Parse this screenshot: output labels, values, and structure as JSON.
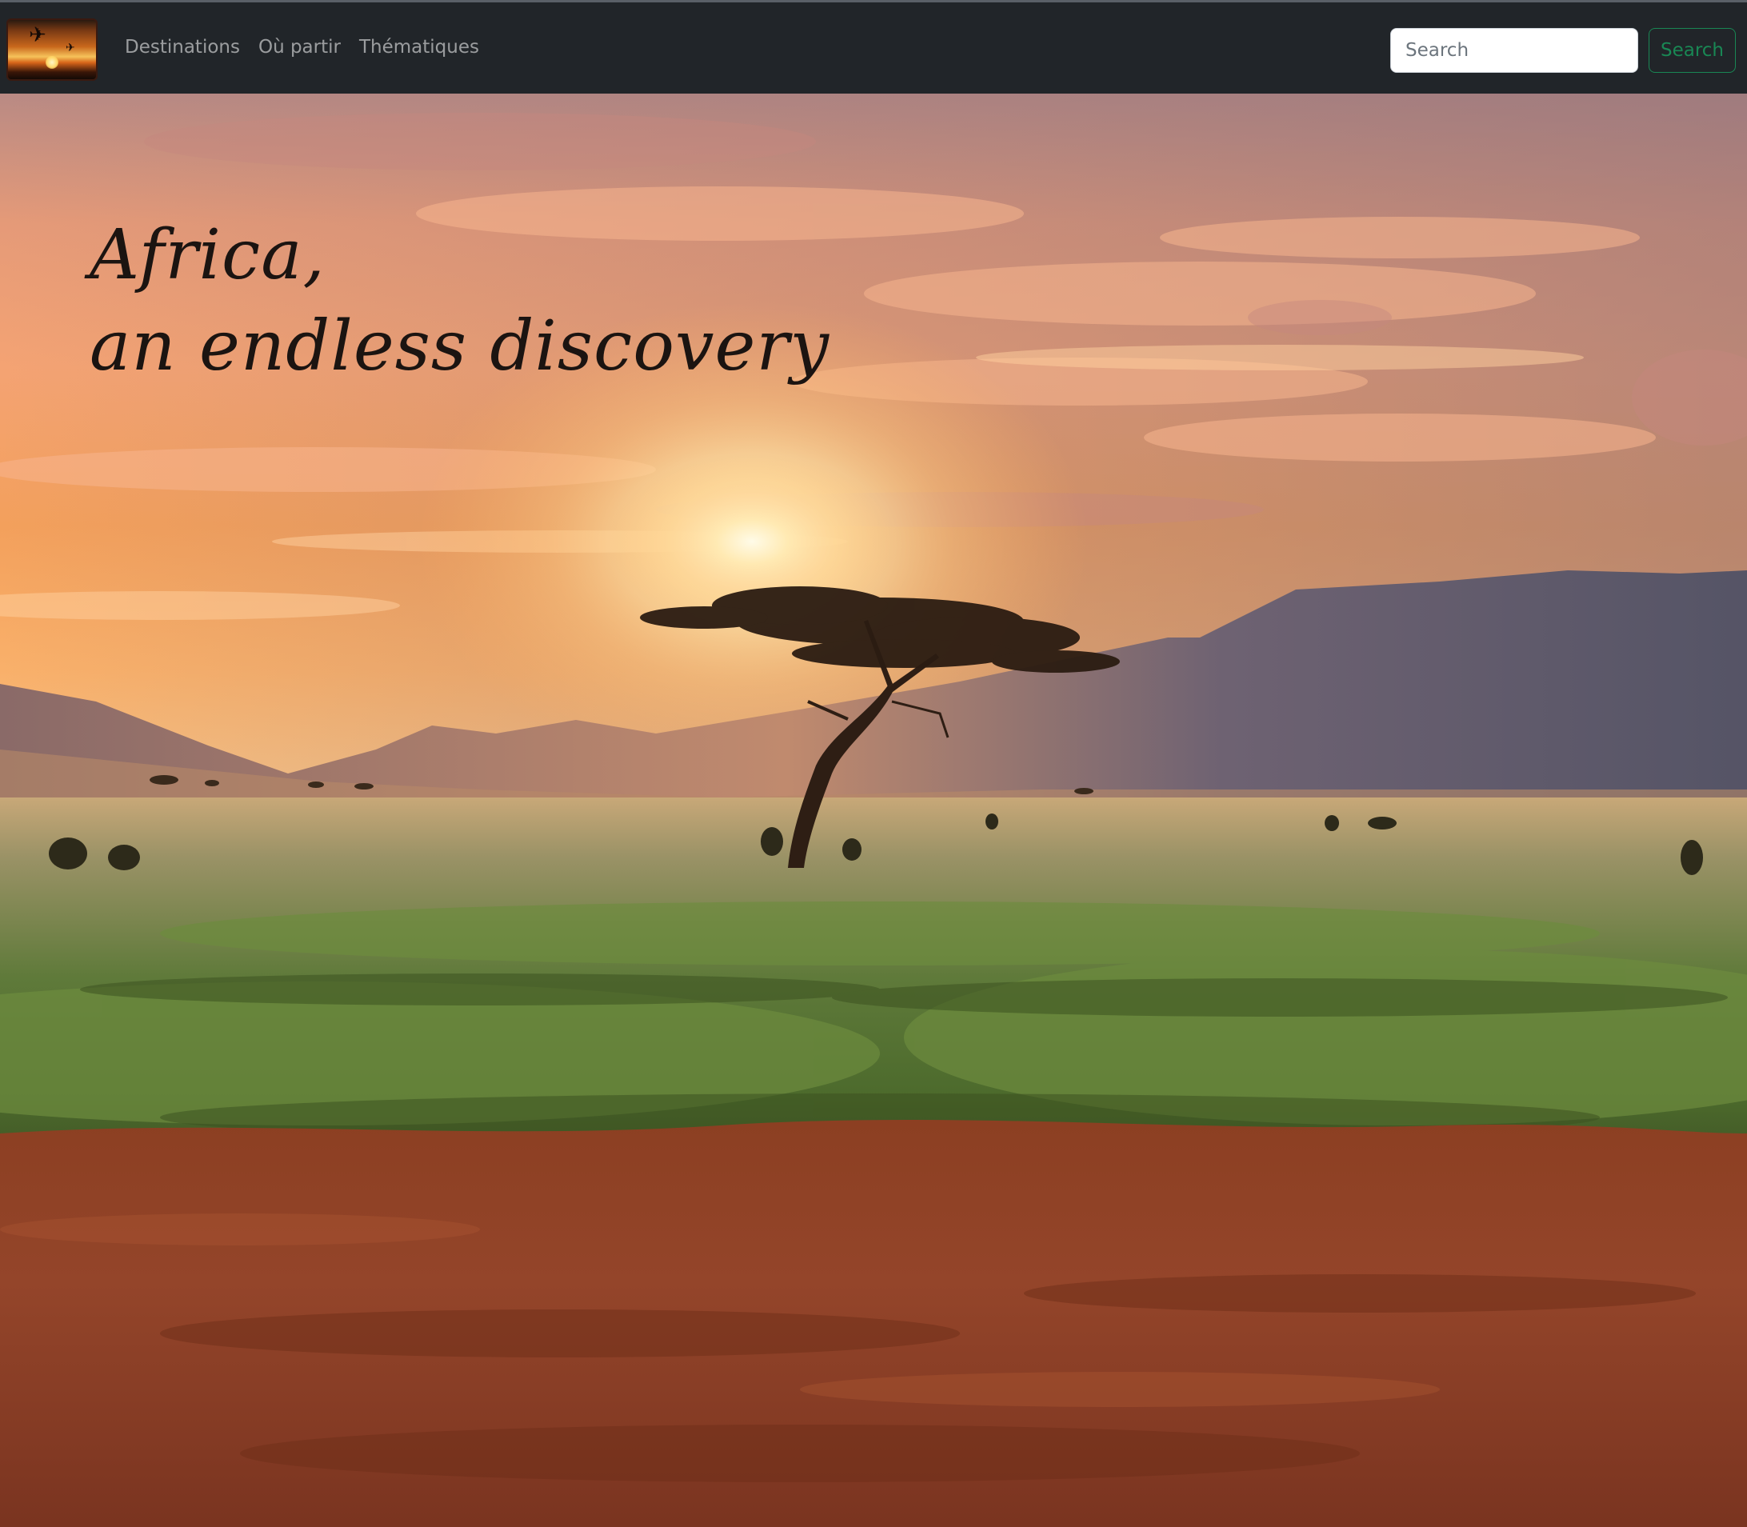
{
  "navbar": {
    "brand_logo_icon": "airplane-sunset-icon",
    "links": [
      "Destinations",
      "Où partir",
      "Thématiques"
    ]
  },
  "search": {
    "placeholder": "Search",
    "value": "",
    "button_label": "Search"
  },
  "hero": {
    "title_line1": "Africa,",
    "title_line2": "an endless discovery",
    "image_icon": "savanna-sunset-photo"
  },
  "colors": {
    "navbar_bg": "#212529",
    "nav_link": "#8c8f92",
    "search_button": "#198754",
    "hero_title": "#1b1411"
  }
}
